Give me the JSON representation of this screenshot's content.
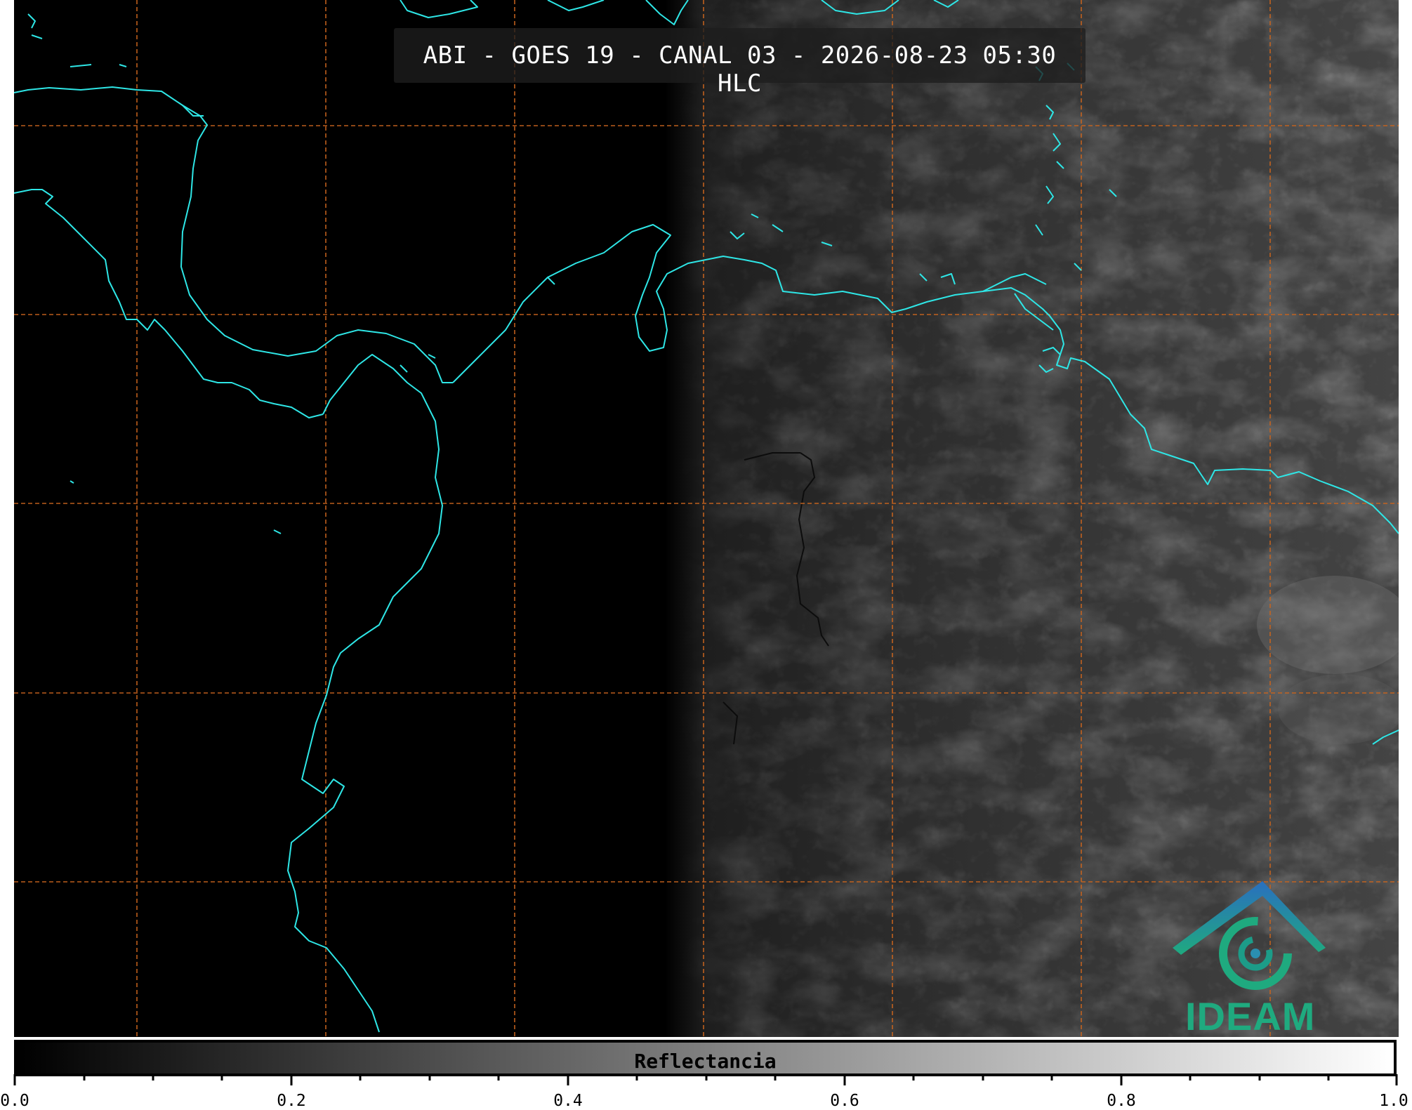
{
  "title": "ABI - GOES 19 - CANAL 03 - 2026-08-23 05:30 HLC",
  "logo_text": "IDEAM",
  "colorbar": {
    "label": "Reflectancia",
    "tick_labels": [
      "0.0",
      "0.2",
      "0.4",
      "0.6",
      "0.8",
      "1.0"
    ],
    "min": 0.0,
    "max": 1.0,
    "colormap": [
      "#000000",
      "#ffffff"
    ]
  },
  "colors": {
    "coastline": "#2ee6e6",
    "graticule": "#c8641e",
    "background": "#000000",
    "logo_teal": "#1faa7f",
    "logo_blue": "#2a6fbf"
  },
  "map": {
    "features": [
      "coastline",
      "country-borders",
      "lat-lon-graticule",
      "cloud-reflectance"
    ],
    "grid_style": "dashed"
  }
}
